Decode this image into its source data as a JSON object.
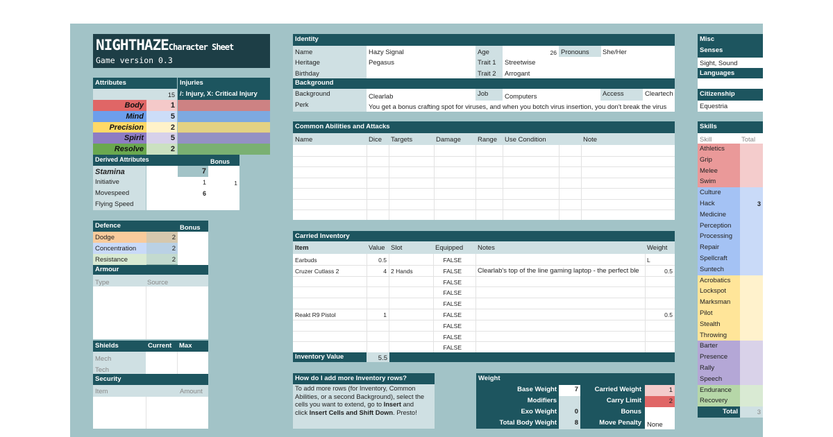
{
  "title": {
    "main": "NIGHTHAZE",
    "sub": "Character Sheet",
    "version": "Game version 0.3"
  },
  "attributes": {
    "header": "Attributes",
    "total": "15",
    "items": [
      {
        "name": "Body",
        "value": "1",
        "color": "#e06666"
      },
      {
        "name": "Mind",
        "value": "5",
        "color": "#6d9eeb"
      },
      {
        "name": "Precision",
        "value": "2",
        "color": "#ffd966"
      },
      {
        "name": "Spirit",
        "value": "5",
        "color": "#8e7cc3"
      },
      {
        "name": "Resolve",
        "value": "2",
        "color": "#6aa84f"
      }
    ]
  },
  "injuries": {
    "header": "Injuries",
    "legend": "/: Injury, X: Critical Injury"
  },
  "derived": {
    "header": "Derived Attributes",
    "bonus_header": "Bonus",
    "rows": [
      {
        "name": "Stamina",
        "value": "7",
        "bonus": ""
      },
      {
        "name": "Initiative",
        "value": "1",
        "bonus": "1"
      },
      {
        "name": "Movespeed",
        "value": "6",
        "bonus": ""
      },
      {
        "name": "Flying Speed",
        "value": "",
        "bonus": ""
      }
    ]
  },
  "defence": {
    "header": "Defence",
    "bonus_header": "Bonus",
    "rows": [
      {
        "name": "Dodge",
        "value": "2",
        "color": "#f9cb9c"
      },
      {
        "name": "Concentration",
        "value": "2",
        "color": "#c9daf8"
      },
      {
        "name": "Resistance",
        "value": "2",
        "color": "#d9ead3"
      }
    ]
  },
  "armour": {
    "header": "Armour",
    "cols": [
      "Type",
      "Source"
    ]
  },
  "shields": {
    "header": "Shields",
    "current": "Current",
    "max": "Max",
    "rows": [
      "Mech",
      "Tech"
    ]
  },
  "security": {
    "header": "Security",
    "cols": [
      "Item",
      "Amount"
    ]
  },
  "identity": {
    "header": "Identity",
    "name_label": "Name",
    "name": "Hazy Signal",
    "age_label": "Age",
    "age": "26",
    "pronouns_label": "Pronouns",
    "pronouns": "She/Her",
    "heritage_label": "Heritage",
    "heritage": "Pegasus",
    "trait1_label": "Trait 1",
    "trait1": "Streetwise",
    "birthday_label": "Birthday",
    "birthday": "",
    "trait2_label": "Trait 2",
    "trait2": "Arrogant"
  },
  "background": {
    "header": "Background",
    "bg_label": "Background",
    "bg": "Clearlab",
    "job_label": "Job",
    "job": "Computers",
    "access_label": "Access",
    "access": "Cleartech",
    "perk_label": "Perk",
    "perk": "You get a bonus crafting spot for viruses, and when you botch virus insertion, you don't break the virus"
  },
  "abilities": {
    "header": "Common Abilities and Attacks",
    "cols": [
      "Name",
      "Dice",
      "Targets",
      "Damage",
      "Range",
      "Use Condition",
      "Note"
    ]
  },
  "inventory": {
    "header": "Carried Inventory",
    "cols": [
      "Item",
      "Value",
      "Slot",
      "Equipped",
      "Notes",
      "Weight"
    ],
    "rows": [
      {
        "item": "Earbuds",
        "value": "0.5",
        "slot": "",
        "equipped": "FALSE",
        "notes": "",
        "weight": "L"
      },
      {
        "item": "Cruzer Cutlass 2",
        "value": "4",
        "slot": "2 Hands",
        "equipped": "FALSE",
        "notes": "Clearlab's top of the line gaming laptop - the perfect ble",
        "weight": "0.5"
      },
      {
        "item": "",
        "value": "",
        "slot": "",
        "equipped": "FALSE",
        "notes": "",
        "weight": ""
      },
      {
        "item": "",
        "value": "",
        "slot": "",
        "equipped": "FALSE",
        "notes": "",
        "weight": ""
      },
      {
        "item": "",
        "value": "",
        "slot": "",
        "equipped": "FALSE",
        "notes": "",
        "weight": ""
      },
      {
        "item": "Reakt R9 Pistol",
        "value": "1",
        "slot": "",
        "equipped": "FALSE",
        "notes": "",
        "weight": "0.5"
      },
      {
        "item": "",
        "value": "",
        "slot": "",
        "equipped": "FALSE",
        "notes": "",
        "weight": ""
      },
      {
        "item": "",
        "value": "",
        "slot": "",
        "equipped": "FALSE",
        "notes": "",
        "weight": ""
      },
      {
        "item": "",
        "value": "",
        "slot": "",
        "equipped": "FALSE",
        "notes": "",
        "weight": ""
      }
    ],
    "value_label": "Inventory Value",
    "value_total": "5.5"
  },
  "howto": {
    "header": "How do I add more Inventory rows?",
    "text1": "To add more rows (for Inventory, Common",
    "text2": "Abilities, or a second Background), select the",
    "text3a": "cells you want to extend, go to ",
    "insert": "Insert",
    "text3b": " and",
    "text4a": "click ",
    "shift": "Insert Cells and Shift Down",
    "text4b": ". Presto!"
  },
  "weight": {
    "header": "Weight",
    "base_label": "Base Weight",
    "base": "7",
    "carried_label": "Carried Weight",
    "carried": "1",
    "mod_label": "Modifiers",
    "mod": "",
    "limit_label": "Carry Limit",
    "limit": "2",
    "exo_label": "Exo Weight",
    "exo": "0",
    "bonus_label": "Bonus",
    "bonus": "",
    "total_label": "Total Body Weight",
    "total": "8",
    "penalty_label": "Move Penalty",
    "penalty": "None"
  },
  "misc": {
    "header": "Misc",
    "senses_header": "Senses",
    "senses": "Sight, Sound",
    "languages_header": "Languages",
    "citizenship_header": "Citizenship",
    "citizenship": "Equestria"
  },
  "skills": {
    "header": "Skills",
    "skill_col": "Skill",
    "total_col": "Total",
    "total_label": "Total",
    "grand_total": "3",
    "groups": [
      {
        "color": "#ea9999",
        "light": "#f4cccc",
        "items": [
          {
            "name": "Athletics",
            "value": ""
          },
          {
            "name": "Grip",
            "value": ""
          },
          {
            "name": "Melee",
            "value": ""
          },
          {
            "name": "Swim",
            "value": ""
          }
        ]
      },
      {
        "color": "#a4c2f4",
        "light": "#c9daf8",
        "items": [
          {
            "name": "Culture",
            "value": ""
          },
          {
            "name": "Hack",
            "value": "3"
          },
          {
            "name": "Medicine",
            "value": ""
          },
          {
            "name": "Perception",
            "value": ""
          },
          {
            "name": "Processing",
            "value": ""
          },
          {
            "name": "Repair",
            "value": ""
          },
          {
            "name": "Spellcraft",
            "value": ""
          },
          {
            "name": "Suntech",
            "value": ""
          }
        ]
      },
      {
        "color": "#ffe599",
        "light": "#fff2cc",
        "items": [
          {
            "name": "Acrobatics",
            "value": ""
          },
          {
            "name": "Lockspot",
            "value": ""
          },
          {
            "name": "Marksman",
            "value": ""
          },
          {
            "name": "Pilot",
            "value": ""
          },
          {
            "name": "Stealth",
            "value": ""
          },
          {
            "name": "Throwing",
            "value": ""
          }
        ]
      },
      {
        "color": "#b4a7d6",
        "light": "#d9d2e9",
        "items": [
          {
            "name": "Barter",
            "value": ""
          },
          {
            "name": "Presence",
            "value": ""
          },
          {
            "name": "Rally",
            "value": ""
          },
          {
            "name": "Speech",
            "value": ""
          }
        ]
      },
      {
        "color": "#b6d7a8",
        "light": "#d9ead3",
        "items": [
          {
            "name": "Endurance",
            "value": ""
          },
          {
            "name": "Recovery",
            "value": ""
          }
        ]
      }
    ]
  }
}
